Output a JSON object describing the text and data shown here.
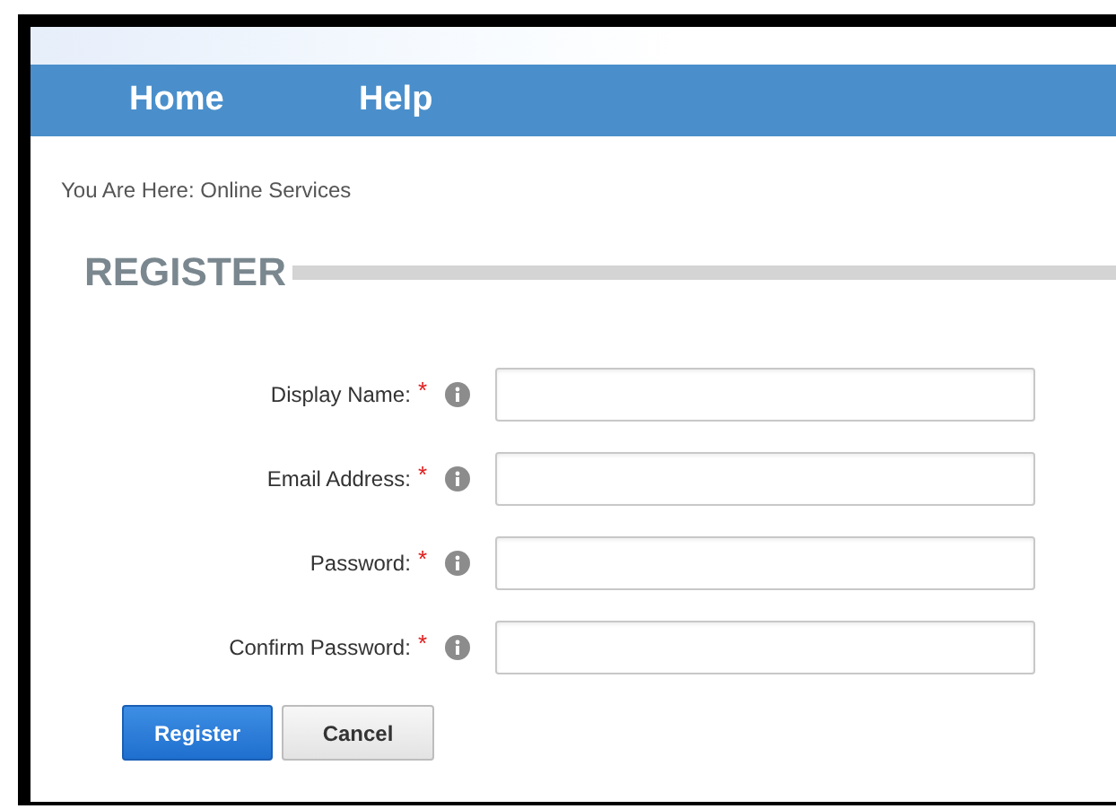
{
  "nav": [
    {
      "label": "Home"
    },
    {
      "label": "Help"
    }
  ],
  "breadcrumb": "You Are Here: Online Services",
  "heading": "REGISTER",
  "fields": [
    {
      "label": "Display Name:",
      "required": true
    },
    {
      "label": "Email Address:",
      "required": true
    },
    {
      "label": "Password:",
      "required": true
    },
    {
      "label": "Confirm Password:",
      "required": true
    }
  ],
  "required_mark": "*",
  "buttons": [
    {
      "label": "Register",
      "kind": "primary"
    },
    {
      "label": "Cancel",
      "kind": "secondary"
    }
  ]
}
